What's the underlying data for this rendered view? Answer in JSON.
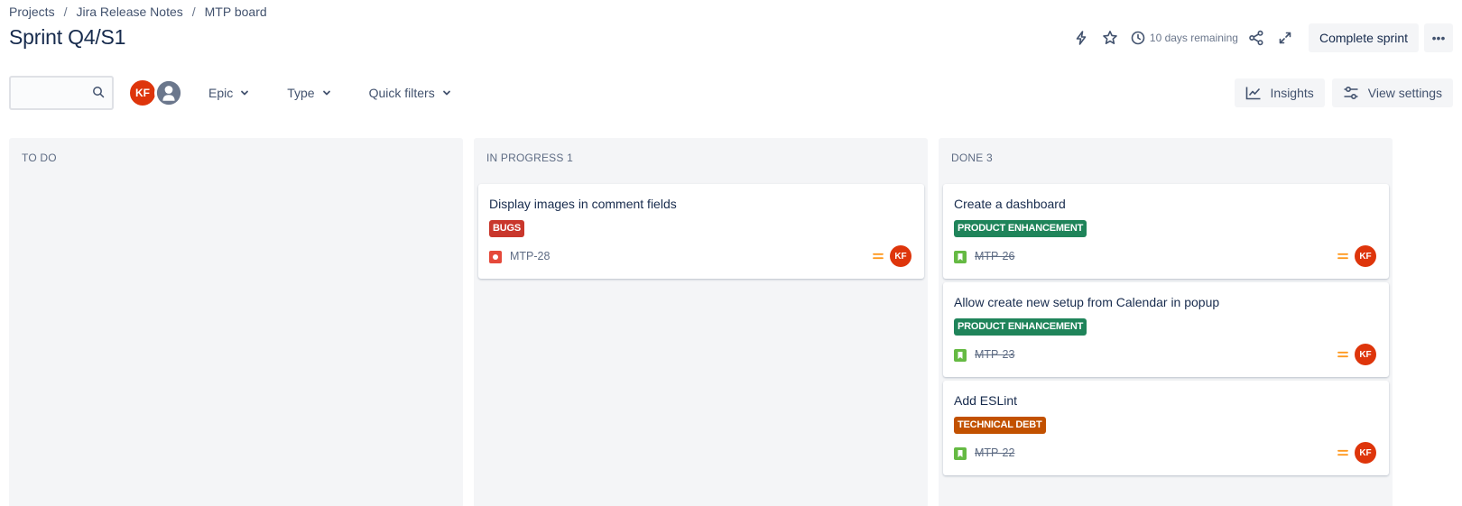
{
  "breadcrumb": [
    "Projects",
    "Jira Release Notes",
    "MTP board"
  ],
  "page_title": "Sprint Q4/S1",
  "header": {
    "remaining": "10 days remaining",
    "complete_label": "Complete sprint",
    "more_label": "•••"
  },
  "toolbar": {
    "search_placeholder": "",
    "avatar_initials": "KF",
    "filters": [
      "Epic",
      "Type",
      "Quick filters"
    ],
    "insights_label": "Insights",
    "view_settings_label": "View settings"
  },
  "colors": {
    "bugs_label": "#c9372c",
    "product_label": "#1f845a",
    "techdebt_label": "#c25100",
    "avatar": "#de350b",
    "priority_medium": "#ff991f",
    "bug_icon": "#e5493a",
    "story_icon": "#65ba43"
  },
  "columns": [
    {
      "name": "TO DO",
      "count": "",
      "cards": []
    },
    {
      "name": "IN PROGRESS",
      "count": "1",
      "cards": [
        {
          "title": "Display images in comment fields",
          "label": "BUGS",
          "type": "bug",
          "key": "MTP-28",
          "done": false,
          "priority": "medium",
          "assignee": "KF"
        }
      ]
    },
    {
      "name": "DONE",
      "count": "3",
      "cards": [
        {
          "title": "Create a dashboard",
          "label": "PRODUCT ENHANCEMENT",
          "type": "story",
          "key": "MTP-26",
          "done": true,
          "priority": "medium",
          "assignee": "KF"
        },
        {
          "title": "Allow create new setup from Calendar in popup",
          "label": "PRODUCT ENHANCEMENT",
          "type": "story",
          "key": "MTP-23",
          "done": true,
          "priority": "medium",
          "assignee": "KF"
        },
        {
          "title": "Add ESLint",
          "label": "TECHNICAL DEBT",
          "type": "story",
          "key": "MTP-22",
          "done": true,
          "priority": "medium",
          "assignee": "KF"
        }
      ]
    }
  ]
}
